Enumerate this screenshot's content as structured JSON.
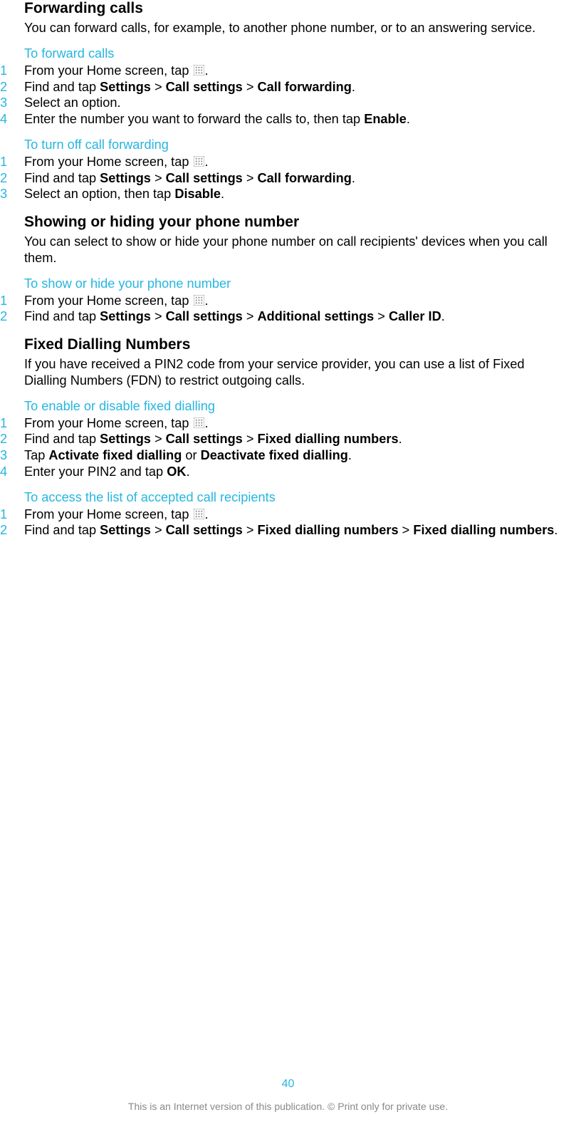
{
  "sections": [
    {
      "heading": "Forwarding calls",
      "body": "You can forward calls, for example, to another phone number, or to an answering service.",
      "subs": [
        {
          "title": "To forward calls",
          "steps": [
            {
              "n": "1",
              "pre": "From your Home screen, tap ",
              "icon": true,
              "post": "."
            },
            {
              "n": "2",
              "html": "Find and tap <b>Settings</b> > <b>Call settings</b> > <b>Call forwarding</b>."
            },
            {
              "n": "3",
              "html": "Select an option."
            },
            {
              "n": "4",
              "html": "Enter the number you want to forward the calls to, then tap <b>Enable</b>."
            }
          ]
        },
        {
          "title": "To turn off call forwarding",
          "steps": [
            {
              "n": "1",
              "pre": "From your Home screen, tap ",
              "icon": true,
              "post": "."
            },
            {
              "n": "2",
              "html": "Find and tap <b>Settings</b> > <b>Call settings</b> > <b>Call forwarding</b>."
            },
            {
              "n": "3",
              "html": "Select an option, then tap <b>Disable</b>."
            }
          ]
        }
      ]
    },
    {
      "heading": "Showing or hiding your phone number",
      "body": "You can select to show or hide your phone number on call recipients' devices when you call them.",
      "subs": [
        {
          "title": "To show or hide your phone number",
          "steps": [
            {
              "n": "1",
              "pre": "From your Home screen, tap ",
              "icon": true,
              "post": "."
            },
            {
              "n": "2",
              "html": "Find and tap <b>Settings</b> > <b>Call settings</b> > <b>Additional settings</b> > <b>Caller ID</b>."
            }
          ]
        }
      ]
    },
    {
      "heading": "Fixed Dialling Numbers",
      "body": "If you have received a PIN2 code from your service provider, you can use a list of Fixed Dialling Numbers (FDN) to restrict outgoing calls.",
      "subs": [
        {
          "title": "To enable or disable fixed dialling",
          "steps": [
            {
              "n": "1",
              "pre": "From your Home screen, tap ",
              "icon": true,
              "post": "."
            },
            {
              "n": "2",
              "html": "Find and tap <b>Settings</b> > <b>Call settings</b> > <b>Fixed dialling numbers</b>."
            },
            {
              "n": "3",
              "html": "Tap <b>Activate fixed dialling</b> or <b>Deactivate fixed dialling</b>."
            },
            {
              "n": "4",
              "html": "Enter your PIN2 and tap <b>OK</b>."
            }
          ]
        },
        {
          "title": "To access the list of accepted call recipients",
          "steps": [
            {
              "n": "1",
              "pre": "From your Home screen, tap ",
              "icon": true,
              "post": "."
            },
            {
              "n": "2",
              "html": "Find and tap <b>Settings</b> > <b>Call settings</b> > <b>Fixed dialling numbers</b> > <b>Fixed dialling numbers</b>."
            }
          ]
        }
      ]
    }
  ],
  "page_number": "40",
  "footer": "This is an Internet version of this publication. © Print only for private use."
}
